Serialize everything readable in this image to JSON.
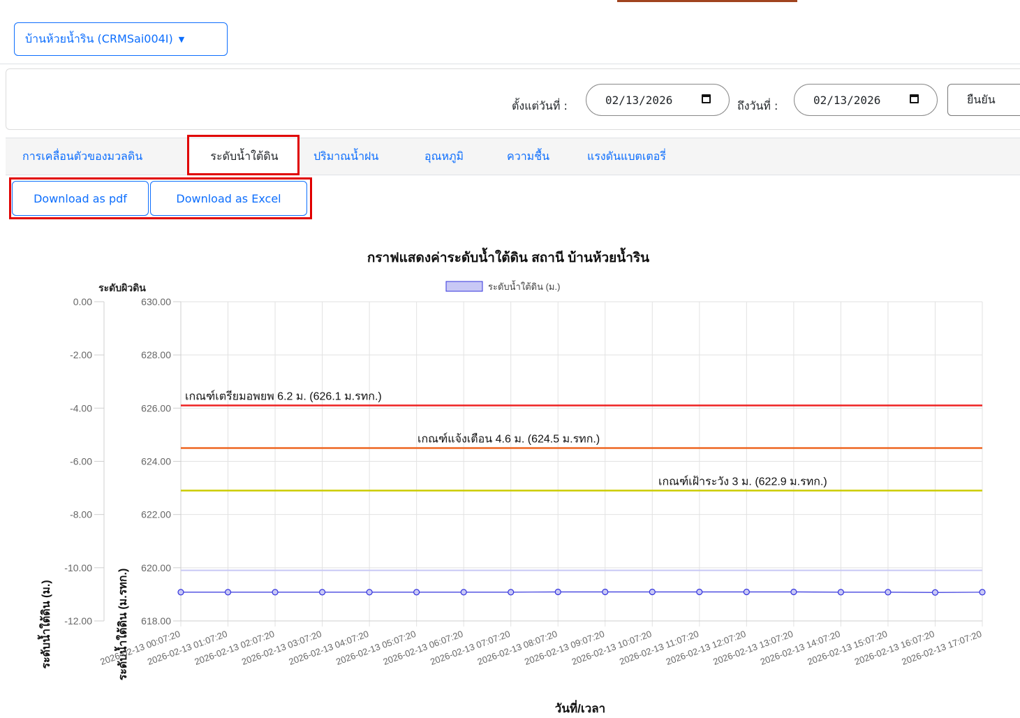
{
  "header": {
    "station_label": "บ้านห้วยน้ำริน (CRMSai004I)"
  },
  "date_filter": {
    "from_label": "ตั้งแต่วันที่ :",
    "from_value": "02/13/2026",
    "to_label": "ถึงวันที่ :",
    "to_value": "02/13/2026",
    "confirm_label": "ยืนยัน"
  },
  "tabs": [
    {
      "label": "การเคลื่อนตัวของมวลดิน",
      "active": false
    },
    {
      "label": "ระดับน้ำใต้ดิน",
      "active": true
    },
    {
      "label": "ปริมาณน้ำฝน",
      "active": false
    },
    {
      "label": "อุณหภูมิ",
      "active": false
    },
    {
      "label": "ความชื้น",
      "active": false
    },
    {
      "label": "แรงดันแบตเตอรี่",
      "active": false
    }
  ],
  "downloads": {
    "pdf_label": "Download as pdf",
    "excel_label": "Download as Excel"
  },
  "colors": {
    "accent": "#0d6efd",
    "highlight": "#e00000",
    "evacuate": "#ee2222",
    "warning": "#ee6622",
    "watch": "#cccc00",
    "series": "#3333dd",
    "legend_fill": "#c8c8f5"
  },
  "chart_data": {
    "type": "line",
    "title": "กราฟแสดงค่าระดับน้ำใต้ดิน สถานี บ้านห้วยน้ำริน",
    "xlabel": "วันที่/เวลา",
    "ylabel_left": "ระดับน้ำใต้ดิน (ม.)",
    "ylabel_right": "ระดับน้ำใต้ดิน (ม.รทก.)",
    "surface_label": "ระดับผิวดิน",
    "y_left_ticks": [
      "0.00",
      "-2.00",
      "-4.00",
      "-6.00",
      "-8.00",
      "-10.00",
      "-12.00"
    ],
    "y_right_ticks": [
      "630.00",
      "628.00",
      "626.00",
      "624.00",
      "622.00",
      "620.00",
      "618.00"
    ],
    "ylim": [
      618,
      630
    ],
    "grid": true,
    "legend_position": "top-center",
    "categories": [
      "2026-02-13 00:07:20",
      "2026-02-13 01:07:20",
      "2026-02-13 02:07:20",
      "2026-02-13 03:07:20",
      "2026-02-13 04:07:20",
      "2026-02-13 05:07:20",
      "2026-02-13 06:07:20",
      "2026-02-13 07:07:20",
      "2026-02-13 08:07:20",
      "2026-02-13 09:07:20",
      "2026-02-13 10:07:20",
      "2026-02-13 11:07:20",
      "2026-02-13 12:07:20",
      "2026-02-13 13:07:20",
      "2026-02-13 14:07:20",
      "2026-02-13 15:07:20",
      "2026-02-13 16:07:20",
      "2026-02-13 17:07:20"
    ],
    "series": [
      {
        "name": "ระดับน้ำใต้ดิน (ม.)",
        "values": [
          619.08,
          619.08,
          619.08,
          619.08,
          619.08,
          619.08,
          619.08,
          619.08,
          619.09,
          619.09,
          619.09,
          619.09,
          619.09,
          619.09,
          619.08,
          619.08,
          619.07,
          619.08
        ]
      }
    ],
    "reference_line": {
      "value": 619.9
    },
    "thresholds": [
      {
        "label": "เกณฑ์เตรียมอพยพ 6.2 ม. (626.1 ม.รทก.)",
        "value": 626.1,
        "color": "#ee2222"
      },
      {
        "label": "เกณฑ์แจ้งเตือน   4.6 ม. (624.5 ม.รทก.)",
        "value": 624.5,
        "color": "#ee6622"
      },
      {
        "label": "เกณฑ์เฝ้าระวัง    3 ม. (622.9 ม.รทก.)",
        "value": 622.9,
        "color": "#cccc00"
      }
    ]
  }
}
